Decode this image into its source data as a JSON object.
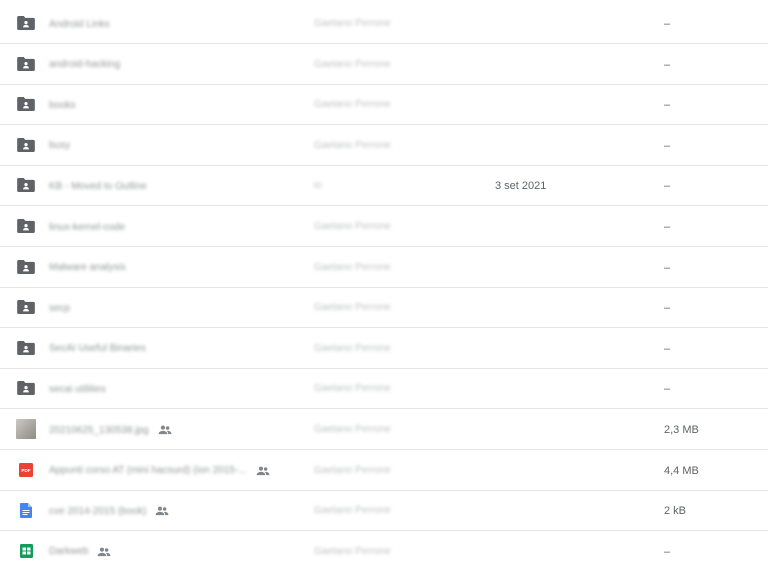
{
  "colors": {
    "folder": "#5f6368",
    "pdf": "#ea4335",
    "doc": "#4285f4",
    "sheet": "#0f9d58",
    "shared": "#80868b"
  },
  "rows": [
    {
      "name": "Android Links",
      "owner": "Gaetano Perrone",
      "modified": "",
      "size": "–",
      "icon": "shared-folder-icon",
      "shared": false
    },
    {
      "name": "android-hacking",
      "owner": "Gaetano Perrone",
      "modified": "",
      "size": "–",
      "icon": "shared-folder-icon",
      "shared": false
    },
    {
      "name": "books",
      "owner": "Gaetano Perrone",
      "modified": "",
      "size": "–",
      "icon": "shared-folder-icon",
      "shared": false
    },
    {
      "name": "busy",
      "owner": "Gaetano Perrone",
      "modified": "",
      "size": "–",
      "icon": "shared-folder-icon",
      "shared": false
    },
    {
      "name": "KB - Moved to Outline",
      "owner": "io",
      "modified": "3 set 2021",
      "size": "–",
      "icon": "shared-folder-icon",
      "shared": false
    },
    {
      "name": "linux-kernel-code",
      "owner": "Gaetano Perrone",
      "modified": "",
      "size": "–",
      "icon": "shared-folder-icon",
      "shared": false
    },
    {
      "name": "Malware analysis",
      "owner": "Gaetano Perrone",
      "modified": "",
      "size": "–",
      "icon": "shared-folder-icon",
      "shared": false
    },
    {
      "name": "secp",
      "owner": "Gaetano Perrone",
      "modified": "",
      "size": "–",
      "icon": "shared-folder-icon",
      "shared": false
    },
    {
      "name": "SecAI Useful Binaries",
      "owner": "Gaetano Perrone",
      "modified": "",
      "size": "–",
      "icon": "shared-folder-icon",
      "shared": false
    },
    {
      "name": "secai utilities",
      "owner": "Gaetano Perrone",
      "modified": "",
      "size": "–",
      "icon": "shared-folder-icon",
      "shared": false
    },
    {
      "name": "20210625_130538.jpg",
      "owner": "Gaetano Perrone",
      "modified": "",
      "size": "2,3 MB",
      "icon": "image-thumbnail-icon",
      "shared": true
    },
    {
      "name": "Appunti corso AT (mini hacsurd) (ion 2015-...",
      "owner": "Gaetano Perrone",
      "modified": "",
      "size": "4,4 MB",
      "icon": "pdf-icon",
      "shared": true
    },
    {
      "name": "cve 2014-2015 (book)",
      "owner": "Gaetano Perrone",
      "modified": "",
      "size": "2 kB",
      "icon": "doc-icon",
      "shared": true
    },
    {
      "name": "Darkweb",
      "owner": "Gaetano Perrone",
      "modified": "",
      "size": "–",
      "icon": "sheet-icon",
      "shared": true
    }
  ]
}
